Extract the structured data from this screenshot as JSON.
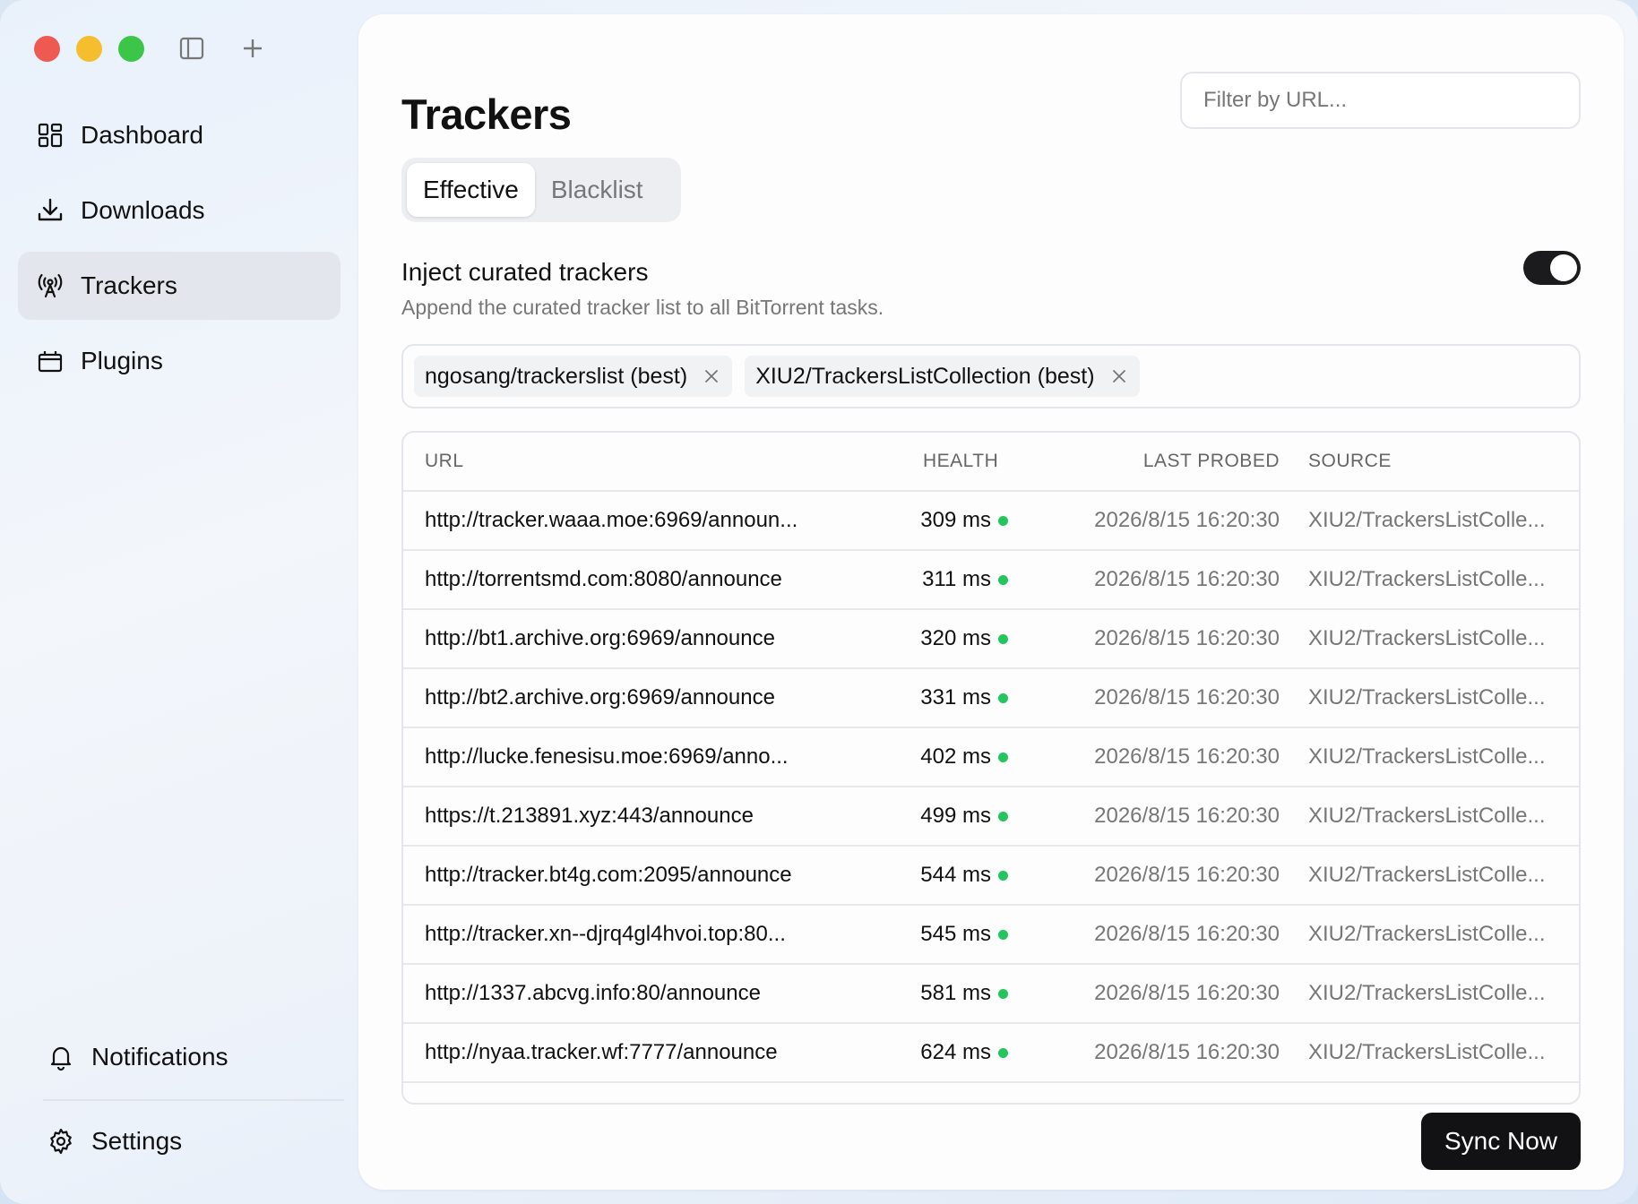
{
  "sidebar": {
    "nav": [
      {
        "label": "Dashboard",
        "icon": "dashboard-grid-icon"
      },
      {
        "label": "Downloads",
        "icon": "download-icon"
      },
      {
        "label": "Trackers",
        "icon": "broadcast-antenna-icon",
        "active": true
      },
      {
        "label": "Plugins",
        "icon": "plugin-box-icon"
      }
    ],
    "notifications_label": "Notifications",
    "settings_label": "Settings"
  },
  "main": {
    "title": "Trackers",
    "filter_placeholder": "Filter by URL...",
    "tabs": [
      {
        "label": "Effective",
        "active": true
      },
      {
        "label": "Blacklist",
        "active": false
      }
    ],
    "inject": {
      "title": "Inject curated trackers",
      "description": "Append the curated tracker list to all BitTorrent tasks.",
      "enabled": true
    },
    "chips": [
      {
        "label": "ngosang/trackerslist (best)"
      },
      {
        "label": "XIU2/TrackersListCollection (best)"
      }
    ],
    "table": {
      "headers": {
        "url": "URL",
        "health": "HEALTH",
        "last_probed": "LAST PROBED",
        "source": "SOURCE"
      },
      "rows": [
        {
          "url": "http://tracker.waaa.moe:6969/announ...",
          "health": "309 ms",
          "last_probed": "2026/8/15 16:20:30",
          "source": "XIU2/TrackersListColle..."
        },
        {
          "url": "http://torrentsmd.com:8080/announce",
          "health": "311 ms",
          "last_probed": "2026/8/15 16:20:30",
          "source": "XIU2/TrackersListColle..."
        },
        {
          "url": "http://bt1.archive.org:6969/announce",
          "health": "320 ms",
          "last_probed": "2026/8/15 16:20:30",
          "source": "XIU2/TrackersListColle..."
        },
        {
          "url": "http://bt2.archive.org:6969/announce",
          "health": "331 ms",
          "last_probed": "2026/8/15 16:20:30",
          "source": "XIU2/TrackersListColle..."
        },
        {
          "url": "http://lucke.fenesisu.moe:6969/anno...",
          "health": "402 ms",
          "last_probed": "2026/8/15 16:20:30",
          "source": "XIU2/TrackersListColle..."
        },
        {
          "url": "https://t.213891.xyz:443/announce",
          "health": "499 ms",
          "last_probed": "2026/8/15 16:20:30",
          "source": "XIU2/TrackersListColle..."
        },
        {
          "url": "http://tracker.bt4g.com:2095/announce",
          "health": "544 ms",
          "last_probed": "2026/8/15 16:20:30",
          "source": "XIU2/TrackersListColle..."
        },
        {
          "url": "http://tracker.xn--djrq4gl4hvoi.top:80...",
          "health": "545 ms",
          "last_probed": "2026/8/15 16:20:30",
          "source": "XIU2/TrackersListColle..."
        },
        {
          "url": "http://1337.abcvg.info:80/announce",
          "health": "581 ms",
          "last_probed": "2026/8/15 16:20:30",
          "source": "XIU2/TrackersListColle..."
        },
        {
          "url": "http://nyaa.tracker.wf:7777/announce",
          "health": "624 ms",
          "last_probed": "2026/8/15 16:20:30",
          "source": "XIU2/TrackersListColle..."
        }
      ]
    },
    "sync_label": "Sync Now"
  },
  "colors": {
    "health_good": "#22c55e",
    "accent_dark": "#121214",
    "close": "#ee5a52",
    "minimize": "#f5be2f",
    "maximize": "#3cc649"
  }
}
